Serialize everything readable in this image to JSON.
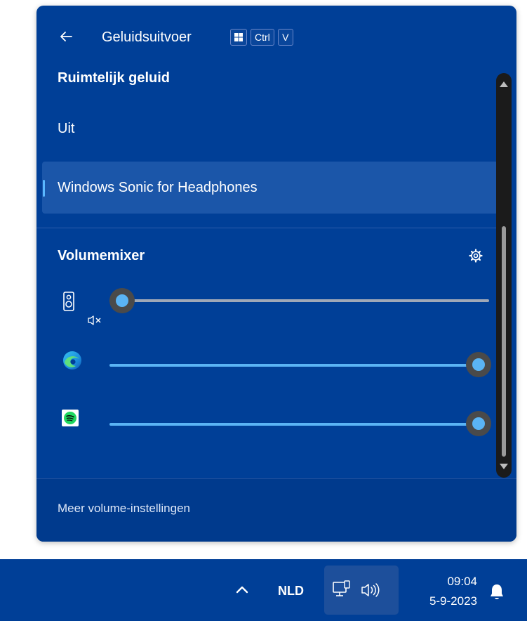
{
  "flyout": {
    "header": {
      "title": "Geluidsuitvoer",
      "shortcut_keys": [
        "Ctrl",
        "V"
      ]
    },
    "spatial_sound": {
      "title": "Ruimtelijk geluid",
      "options": [
        {
          "label": "Uit",
          "selected": false
        },
        {
          "label": "Windows Sonic for Headphones",
          "selected": true
        }
      ]
    },
    "volume_mixer": {
      "title": "Volumemixer",
      "rows": [
        {
          "app_icon": "speaker-device-icon",
          "muted": true,
          "level": 0
        },
        {
          "app_icon": "edge-icon",
          "muted": false,
          "level": 100
        },
        {
          "app_icon": "spotify-icon",
          "muted": false,
          "level": 100
        }
      ]
    },
    "footer": {
      "link": "Meer volume-instellingen"
    }
  },
  "taskbar": {
    "language": "NLD",
    "time": "09:04",
    "date": "5-9-2023"
  },
  "colors": {
    "flyout_bg": "#003f97",
    "selected_bg": "#1b56a9",
    "accent": "#5ab4f5",
    "taskbar_bg": "#003f97"
  }
}
